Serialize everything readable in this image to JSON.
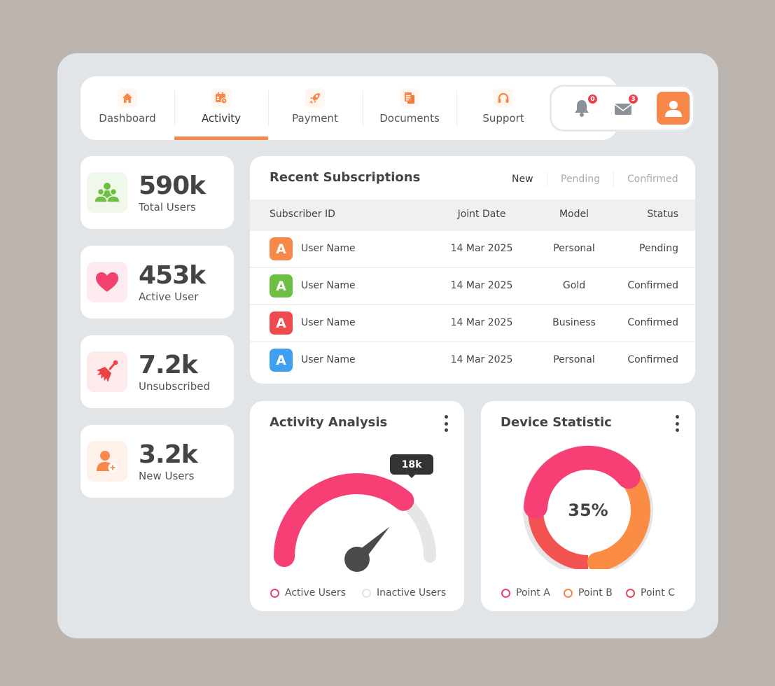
{
  "nav": {
    "items": [
      {
        "label": "Dashboard",
        "icon": "home-icon",
        "active": false
      },
      {
        "label": "Activity",
        "icon": "calendar-clock-icon",
        "active": true
      },
      {
        "label": "Payment",
        "icon": "rocket-icon",
        "active": false
      },
      {
        "label": "Documents",
        "icon": "documents-icon",
        "active": false
      },
      {
        "label": "Support",
        "icon": "headphones-icon",
        "active": false
      }
    ],
    "notifications_count": "0",
    "messages_count": "3"
  },
  "stats": [
    {
      "value": "590k",
      "label": "Total Users",
      "icon": "users-group-icon",
      "color": "#6dbf44",
      "bg": "#eff8ea"
    },
    {
      "value": "453k",
      "label": "Active User",
      "icon": "heart-icon",
      "color": "#f2416f",
      "bg": "#fdebf0"
    },
    {
      "value": "7.2k",
      "label": "Unsubscribed",
      "icon": "broom-icon",
      "color": "#ea4343",
      "bg": "#fdeaea"
    },
    {
      "value": "3.2k",
      "label": "New Users",
      "icon": "user-add-icon",
      "color": "#f6894a",
      "bg": "#fdf1ea"
    }
  ],
  "subscriptions": {
    "title": "Recent Subscriptions",
    "tabs": [
      "New",
      "Pending",
      "Confirmed"
    ],
    "active_tab": "New",
    "columns": [
      "Subscriber ID",
      "Joint Date",
      "Model",
      "Status"
    ],
    "rows": [
      {
        "initial": "A",
        "name": "User Name",
        "date": "14 Mar 2025",
        "model": "Personal",
        "status": "Pending",
        "color": "#f6894a"
      },
      {
        "initial": "A",
        "name": "User Name",
        "date": "14 Mar 2025",
        "model": "Gold",
        "status": "Confirmed",
        "color": "#6dbf44"
      },
      {
        "initial": "A",
        "name": "User Name",
        "date": "14 Mar 2025",
        "model": "Business",
        "status": "Confirmed",
        "color": "#ee4b4f"
      },
      {
        "initial": "A",
        "name": "User Name",
        "date": "14 Mar 2025",
        "model": "Personal",
        "status": "Confirmed",
        "color": "#3ea0ee"
      }
    ]
  },
  "activity": {
    "title": "Activity Analysis",
    "tooltip": "18k",
    "active_fraction": 0.72,
    "legend": [
      {
        "label": "Active Users",
        "color": "#e5447a"
      },
      {
        "label": "Inactive Users",
        "color": "#e3e3e3"
      }
    ]
  },
  "device": {
    "title": "Device Statistic",
    "center_label": "35%",
    "legend": [
      {
        "label": "Point A",
        "color": "#e5447a"
      },
      {
        "label": "Point B",
        "color": "#f0894a"
      },
      {
        "label": "Point C",
        "color": "#e04b55"
      }
    ]
  },
  "chart_data": [
    {
      "type": "gauge",
      "title": "Activity Analysis",
      "series": [
        {
          "name": "Active Users",
          "value": 0.72
        },
        {
          "name": "Inactive Users",
          "value": 0.28
        }
      ],
      "annotation": "18k"
    },
    {
      "type": "pie",
      "title": "Device Statistic",
      "center_label": "35%",
      "categories": [
        "Point A",
        "Point B",
        "Point C"
      ],
      "values": [
        40,
        35,
        25
      ],
      "colors": [
        "#f53f75",
        "#fb8c45",
        "#f25350"
      ]
    }
  ]
}
